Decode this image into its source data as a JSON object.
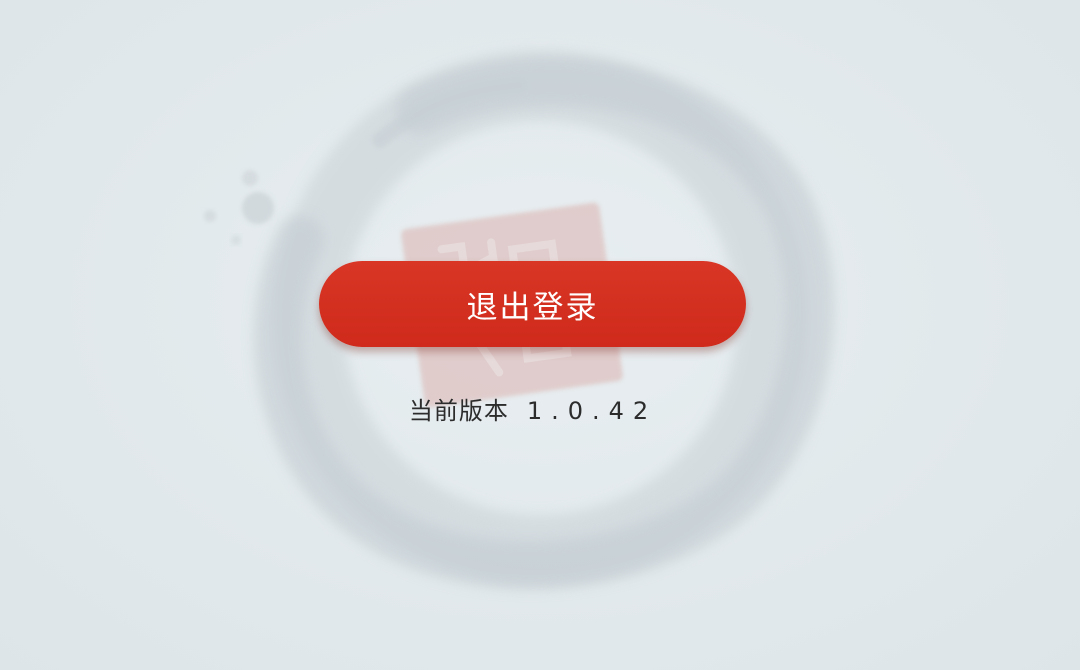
{
  "settings": {
    "logout_label": "退出登录",
    "version_label": "当前版本",
    "version_number": "1.0.42"
  },
  "background": {
    "ink_circle_icon": "ink-brush-circle",
    "seal_stamp_icon": "red-seal-stamp"
  },
  "colors": {
    "accent": "#d3301f",
    "background": "#e3e9ec",
    "text": "#2c2c2c"
  }
}
